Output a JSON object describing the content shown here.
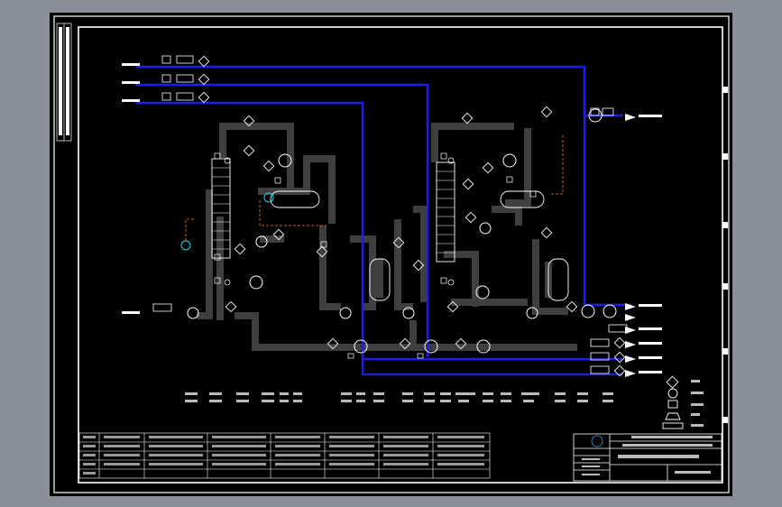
{
  "colors": {
    "viewport_bg": "#8a8f9a",
    "paper": "#000000",
    "frame": "#ffffff",
    "pipe_main": "#3f3f3f",
    "pipe_utility": "#1c1cf0",
    "signal_line": "#ff7a1a",
    "instrument": "#00e5ff",
    "text": "#ffffff"
  },
  "drawing": {
    "title_block_lines": [
      "",
      "",
      "",
      ""
    ],
    "equipment_labels": [],
    "stream_labels": [],
    "legend": {
      "symbols": [
        "diamond",
        "circle",
        "square",
        "parallelogram",
        "rectangle"
      ],
      "captions": []
    }
  }
}
